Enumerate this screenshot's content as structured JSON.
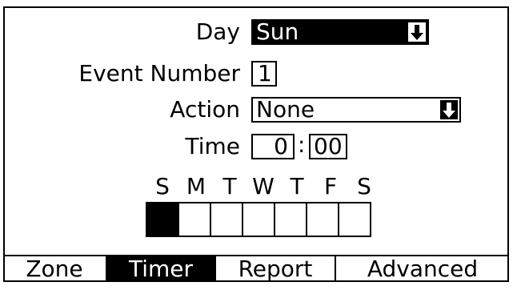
{
  "form": {
    "day": {
      "label": "Day",
      "value": "Sun"
    },
    "event_number": {
      "label": "Event Number",
      "value": "1"
    },
    "action": {
      "label": "Action",
      "value": "None"
    },
    "time": {
      "label": "Time",
      "hours": "0",
      "separator": ":",
      "minutes": "00"
    }
  },
  "weekdays": {
    "letters": [
      "S",
      "M",
      "T",
      "W",
      "T",
      "F",
      "S"
    ],
    "enabled": [
      true,
      false,
      false,
      false,
      false,
      false,
      false
    ]
  },
  "tabs": [
    {
      "label": "Zone",
      "active": false
    },
    {
      "label": "Timer",
      "active": true
    },
    {
      "label": "Report",
      "active": false
    },
    {
      "label": "Advanced",
      "active": false
    }
  ],
  "icons": {
    "dropdown": "down-arrow-icon"
  }
}
